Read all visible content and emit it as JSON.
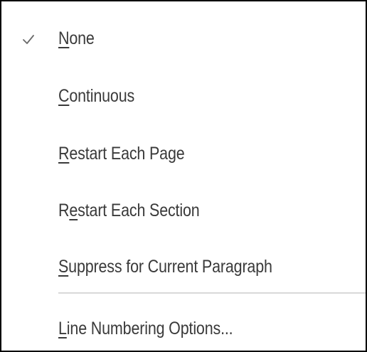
{
  "menu": {
    "items": [
      {
        "mnemonic": "N",
        "rest": "one",
        "checked": true
      },
      {
        "mnemonic": "C",
        "rest": "ontinuous",
        "checked": false
      },
      {
        "mnemonic": "R",
        "rest": "estart Each Page",
        "checked": false
      },
      {
        "pre": "R",
        "mnemonic": "e",
        "rest": "start Each Section",
        "checked": false
      },
      {
        "mnemonic": "S",
        "rest": "uppress for Current Paragraph",
        "checked": false
      },
      {
        "mnemonic": "L",
        "rest": "ine Numbering Options...",
        "checked": false
      }
    ]
  },
  "icons": {
    "checked_item": "checkmark-icon"
  },
  "colors": {
    "text": "#3a3a3a",
    "check": "#6a6a6a",
    "separator": "#d8d8d8",
    "border": "#000000"
  }
}
